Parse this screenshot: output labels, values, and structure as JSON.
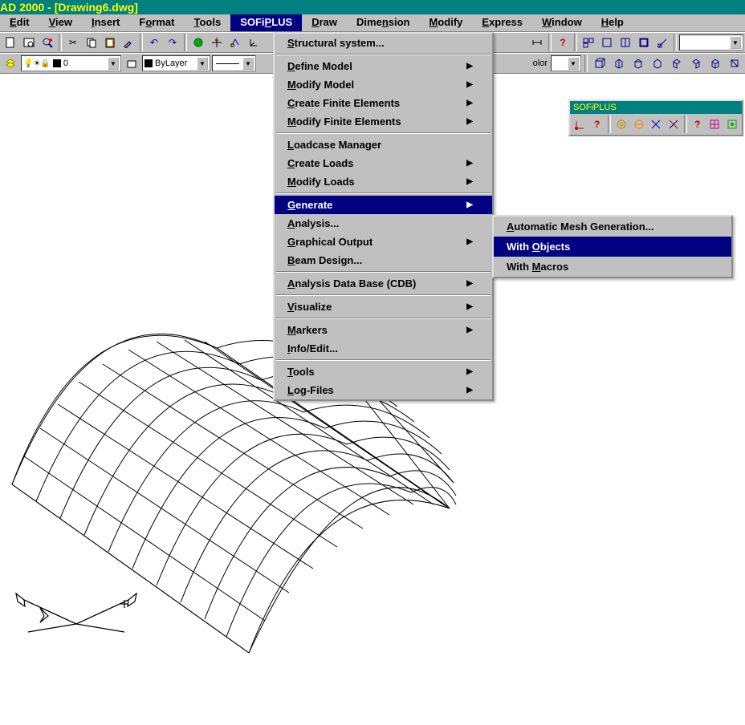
{
  "title": "AD 2000 - [Drawing6.dwg]",
  "menubar": [
    {
      "label": "Edit",
      "u": 0
    },
    {
      "label": "View",
      "u": 0
    },
    {
      "label": "Insert",
      "u": 0
    },
    {
      "label": "Format",
      "u": 1
    },
    {
      "label": "Tools",
      "u": 0
    },
    {
      "label": "SOFiPLUS",
      "u": 4,
      "active": true
    },
    {
      "label": "Draw",
      "u": 0
    },
    {
      "label": "Dimension",
      "u": 4
    },
    {
      "label": "Modify",
      "u": 0
    },
    {
      "label": "Express",
      "u": 0
    },
    {
      "label": "Window",
      "u": 0
    },
    {
      "label": "Help",
      "u": 0
    }
  ],
  "toolbar1_icons": [
    "page",
    "preview",
    "zoom",
    "cut",
    "copy",
    "paste",
    "brush",
    "undo",
    "redo",
    "link",
    "globe",
    "anchor",
    "tracking"
  ],
  "toolbar1_right": {
    "dist": "",
    "help": "?",
    "panels": [
      "p1",
      "p2",
      "p3",
      "p4",
      "p5"
    ],
    "combo": ""
  },
  "toolbar2": {
    "layer_combo": "0",
    "linetype_combo": "ByLayer",
    "line_sample": "",
    "color_label": "olor"
  },
  "toolbar2_right_icons": [
    "cube",
    "box1",
    "box2",
    "box3",
    "box4",
    "box5",
    "box6",
    "box7"
  ],
  "sofiplus_menu": {
    "groups": [
      [
        {
          "label": "Structural system...",
          "u": 0
        }
      ],
      [
        {
          "label": "Define Model",
          "u": 0,
          "sub": true
        },
        {
          "label": "Modify Model",
          "u": 0,
          "sub": true
        },
        {
          "label": "Create Finite Elements",
          "u": 0,
          "sub": true
        },
        {
          "label": "Modify Finite Elements",
          "u": 0,
          "sub": true
        }
      ],
      [
        {
          "label": "Loadcase Manager",
          "u": 0
        },
        {
          "label": "Create Loads",
          "u": 0,
          "sub": true
        },
        {
          "label": "Modify Loads",
          "u": 0,
          "sub": true
        }
      ],
      [
        {
          "label": "Generate",
          "u": 0,
          "sub": true,
          "highlight": true
        },
        {
          "label": "Analysis...",
          "u": 0
        },
        {
          "label": "Graphical Output",
          "u": 0,
          "sub": true
        },
        {
          "label": "Beam Design...",
          "u": 0
        }
      ],
      [
        {
          "label": "Analysis Data Base (CDB)",
          "u": 0,
          "sub": true
        }
      ],
      [
        {
          "label": "Visualize",
          "u": 0,
          "sub": true
        }
      ],
      [
        {
          "label": "Markers",
          "u": 0,
          "sub": true
        },
        {
          "label": "Info/Edit...",
          "u": 0
        }
      ],
      [
        {
          "label": "Tools",
          "u": 0,
          "sub": true
        },
        {
          "label": "Log-Files",
          "u": 0,
          "sub": true
        }
      ]
    ]
  },
  "generate_submenu": [
    {
      "label": "Automatic Mesh Generation...",
      "u": 0
    },
    {
      "label": "With Objects",
      "u": 5,
      "highlight": true
    },
    {
      "label": "With Macros",
      "u": 5
    }
  ],
  "float_toolbar": {
    "title": "SOFiPLUS",
    "icons": [
      "system",
      "help",
      "mesh",
      "mesh2",
      "cross",
      "cross2",
      "help2",
      "grid",
      "grid2"
    ]
  }
}
